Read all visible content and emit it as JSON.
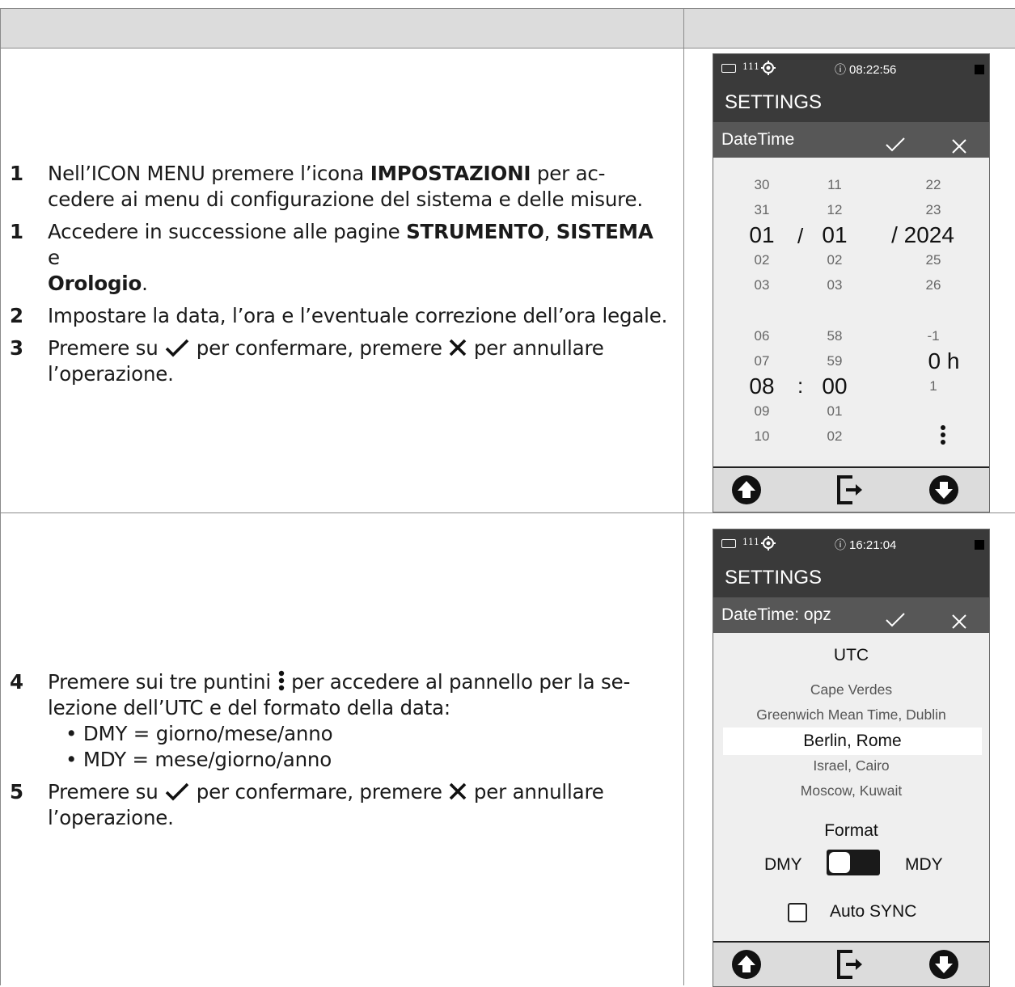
{
  "section1": {
    "steps": [
      {
        "num": "1",
        "pre": "Nell’ICON MENU premere l’icona ",
        "bold": "IMPOSTAZIONI",
        "post": " per ac-",
        "line2": "cedere ai menu di configurazione del sistema e delle misure."
      },
      {
        "num": "1",
        "pre": "Accedere in successione alle pagine ",
        "bold1": "STRUMENTO",
        "sep": ", ",
        "bold2": "SISTEMA",
        "line2": "e",
        "bold3": "Orologio",
        "end": "."
      },
      {
        "num": "2",
        "text": "Impostare la data, l’ora e l’eventuale correzione dell’ora legale."
      },
      {
        "num": "3",
        "pre": "Premere su ",
        "mid": " per confermare, premere ",
        "post": " per annullare",
        "line2": "l’operazione."
      }
    ]
  },
  "section2": {
    "steps": [
      {
        "num": "4",
        "pre": "Premere sui tre puntini ",
        "post": " per accedere al pannello per la se-",
        "line2": "lezione dell’UTC e del formato della data:",
        "bullet1": "• DMY = giorno/mese/anno",
        "bullet2": "• MDY = mese/giorno/anno"
      },
      {
        "num": "5",
        "pre": "Premere su ",
        "mid": " per confermare, premere ",
        "post": " per annullare",
        "line2": "l’operazione."
      }
    ]
  },
  "device1": {
    "status": {
      "signal": "111",
      "clock_icon": "⓪",
      "time": "08:22:56"
    },
    "title": "SETTINGS",
    "subtitle": "DateTime",
    "date_col1": [
      "30",
      "31",
      "01",
      "02",
      "03"
    ],
    "date_col2": [
      "11",
      "12",
      "01",
      "02",
      "03"
    ],
    "date_col3": [
      "22",
      "23",
      "/ 2024",
      "25",
      "26"
    ],
    "date_sep": "/",
    "time_col1": [
      "06",
      "07",
      "08",
      "09",
      "10"
    ],
    "time_col2": [
      "58",
      "59",
      "00",
      "01",
      "02"
    ],
    "time_col3": [
      "-1",
      "0 h",
      "1"
    ],
    "time_sep": ":"
  },
  "device2": {
    "status": {
      "signal": "111",
      "time": "16:21:04"
    },
    "title": "SETTINGS",
    "subtitle": "DateTime: opz",
    "utc_title": "UTC",
    "utc_options": [
      "Cape Verdes",
      "Greenwich Mean Time, Dublin",
      "Berlin, Rome",
      "Israel, Cairo",
      "Moscow, Kuwait"
    ],
    "format_title": "Format",
    "format_left": "DMY",
    "format_right": "MDY",
    "autosync_label": "Auto SYNC"
  }
}
